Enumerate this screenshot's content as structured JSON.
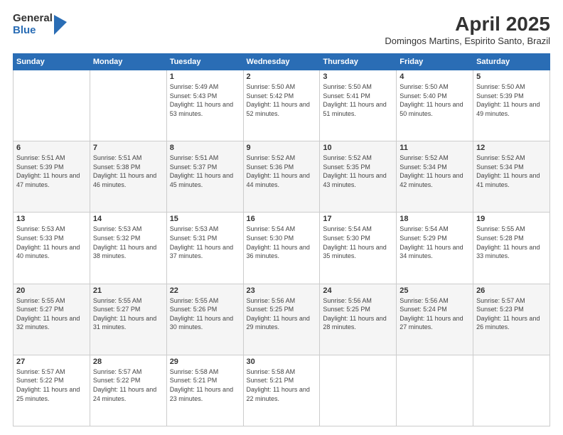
{
  "header": {
    "logo_general": "General",
    "logo_blue": "Blue",
    "month_title": "April 2025",
    "subtitle": "Domingos Martins, Espirito Santo, Brazil"
  },
  "weekdays": [
    "Sunday",
    "Monday",
    "Tuesday",
    "Wednesday",
    "Thursday",
    "Friday",
    "Saturday"
  ],
  "weeks": [
    [
      {
        "day": "",
        "sunrise": "",
        "sunset": "",
        "daylight": ""
      },
      {
        "day": "",
        "sunrise": "",
        "sunset": "",
        "daylight": ""
      },
      {
        "day": "1",
        "sunrise": "Sunrise: 5:49 AM",
        "sunset": "Sunset: 5:43 PM",
        "daylight": "Daylight: 11 hours and 53 minutes."
      },
      {
        "day": "2",
        "sunrise": "Sunrise: 5:50 AM",
        "sunset": "Sunset: 5:42 PM",
        "daylight": "Daylight: 11 hours and 52 minutes."
      },
      {
        "day": "3",
        "sunrise": "Sunrise: 5:50 AM",
        "sunset": "Sunset: 5:41 PM",
        "daylight": "Daylight: 11 hours and 51 minutes."
      },
      {
        "day": "4",
        "sunrise": "Sunrise: 5:50 AM",
        "sunset": "Sunset: 5:40 PM",
        "daylight": "Daylight: 11 hours and 50 minutes."
      },
      {
        "day": "5",
        "sunrise": "Sunrise: 5:50 AM",
        "sunset": "Sunset: 5:39 PM",
        "daylight": "Daylight: 11 hours and 49 minutes."
      }
    ],
    [
      {
        "day": "6",
        "sunrise": "Sunrise: 5:51 AM",
        "sunset": "Sunset: 5:39 PM",
        "daylight": "Daylight: 11 hours and 47 minutes."
      },
      {
        "day": "7",
        "sunrise": "Sunrise: 5:51 AM",
        "sunset": "Sunset: 5:38 PM",
        "daylight": "Daylight: 11 hours and 46 minutes."
      },
      {
        "day": "8",
        "sunrise": "Sunrise: 5:51 AM",
        "sunset": "Sunset: 5:37 PM",
        "daylight": "Daylight: 11 hours and 45 minutes."
      },
      {
        "day": "9",
        "sunrise": "Sunrise: 5:52 AM",
        "sunset": "Sunset: 5:36 PM",
        "daylight": "Daylight: 11 hours and 44 minutes."
      },
      {
        "day": "10",
        "sunrise": "Sunrise: 5:52 AM",
        "sunset": "Sunset: 5:35 PM",
        "daylight": "Daylight: 11 hours and 43 minutes."
      },
      {
        "day": "11",
        "sunrise": "Sunrise: 5:52 AM",
        "sunset": "Sunset: 5:34 PM",
        "daylight": "Daylight: 11 hours and 42 minutes."
      },
      {
        "day": "12",
        "sunrise": "Sunrise: 5:52 AM",
        "sunset": "Sunset: 5:34 PM",
        "daylight": "Daylight: 11 hours and 41 minutes."
      }
    ],
    [
      {
        "day": "13",
        "sunrise": "Sunrise: 5:53 AM",
        "sunset": "Sunset: 5:33 PM",
        "daylight": "Daylight: 11 hours and 40 minutes."
      },
      {
        "day": "14",
        "sunrise": "Sunrise: 5:53 AM",
        "sunset": "Sunset: 5:32 PM",
        "daylight": "Daylight: 11 hours and 38 minutes."
      },
      {
        "day": "15",
        "sunrise": "Sunrise: 5:53 AM",
        "sunset": "Sunset: 5:31 PM",
        "daylight": "Daylight: 11 hours and 37 minutes."
      },
      {
        "day": "16",
        "sunrise": "Sunrise: 5:54 AM",
        "sunset": "Sunset: 5:30 PM",
        "daylight": "Daylight: 11 hours and 36 minutes."
      },
      {
        "day": "17",
        "sunrise": "Sunrise: 5:54 AM",
        "sunset": "Sunset: 5:30 PM",
        "daylight": "Daylight: 11 hours and 35 minutes."
      },
      {
        "day": "18",
        "sunrise": "Sunrise: 5:54 AM",
        "sunset": "Sunset: 5:29 PM",
        "daylight": "Daylight: 11 hours and 34 minutes."
      },
      {
        "day": "19",
        "sunrise": "Sunrise: 5:55 AM",
        "sunset": "Sunset: 5:28 PM",
        "daylight": "Daylight: 11 hours and 33 minutes."
      }
    ],
    [
      {
        "day": "20",
        "sunrise": "Sunrise: 5:55 AM",
        "sunset": "Sunset: 5:27 PM",
        "daylight": "Daylight: 11 hours and 32 minutes."
      },
      {
        "day": "21",
        "sunrise": "Sunrise: 5:55 AM",
        "sunset": "Sunset: 5:27 PM",
        "daylight": "Daylight: 11 hours and 31 minutes."
      },
      {
        "day": "22",
        "sunrise": "Sunrise: 5:55 AM",
        "sunset": "Sunset: 5:26 PM",
        "daylight": "Daylight: 11 hours and 30 minutes."
      },
      {
        "day": "23",
        "sunrise": "Sunrise: 5:56 AM",
        "sunset": "Sunset: 5:25 PM",
        "daylight": "Daylight: 11 hours and 29 minutes."
      },
      {
        "day": "24",
        "sunrise": "Sunrise: 5:56 AM",
        "sunset": "Sunset: 5:25 PM",
        "daylight": "Daylight: 11 hours and 28 minutes."
      },
      {
        "day": "25",
        "sunrise": "Sunrise: 5:56 AM",
        "sunset": "Sunset: 5:24 PM",
        "daylight": "Daylight: 11 hours and 27 minutes."
      },
      {
        "day": "26",
        "sunrise": "Sunrise: 5:57 AM",
        "sunset": "Sunset: 5:23 PM",
        "daylight": "Daylight: 11 hours and 26 minutes."
      }
    ],
    [
      {
        "day": "27",
        "sunrise": "Sunrise: 5:57 AM",
        "sunset": "Sunset: 5:22 PM",
        "daylight": "Daylight: 11 hours and 25 minutes."
      },
      {
        "day": "28",
        "sunrise": "Sunrise: 5:57 AM",
        "sunset": "Sunset: 5:22 PM",
        "daylight": "Daylight: 11 hours and 24 minutes."
      },
      {
        "day": "29",
        "sunrise": "Sunrise: 5:58 AM",
        "sunset": "Sunset: 5:21 PM",
        "daylight": "Daylight: 11 hours and 23 minutes."
      },
      {
        "day": "30",
        "sunrise": "Sunrise: 5:58 AM",
        "sunset": "Sunset: 5:21 PM",
        "daylight": "Daylight: 11 hours and 22 minutes."
      },
      {
        "day": "",
        "sunrise": "",
        "sunset": "",
        "daylight": ""
      },
      {
        "day": "",
        "sunrise": "",
        "sunset": "",
        "daylight": ""
      },
      {
        "day": "",
        "sunrise": "",
        "sunset": "",
        "daylight": ""
      }
    ]
  ]
}
